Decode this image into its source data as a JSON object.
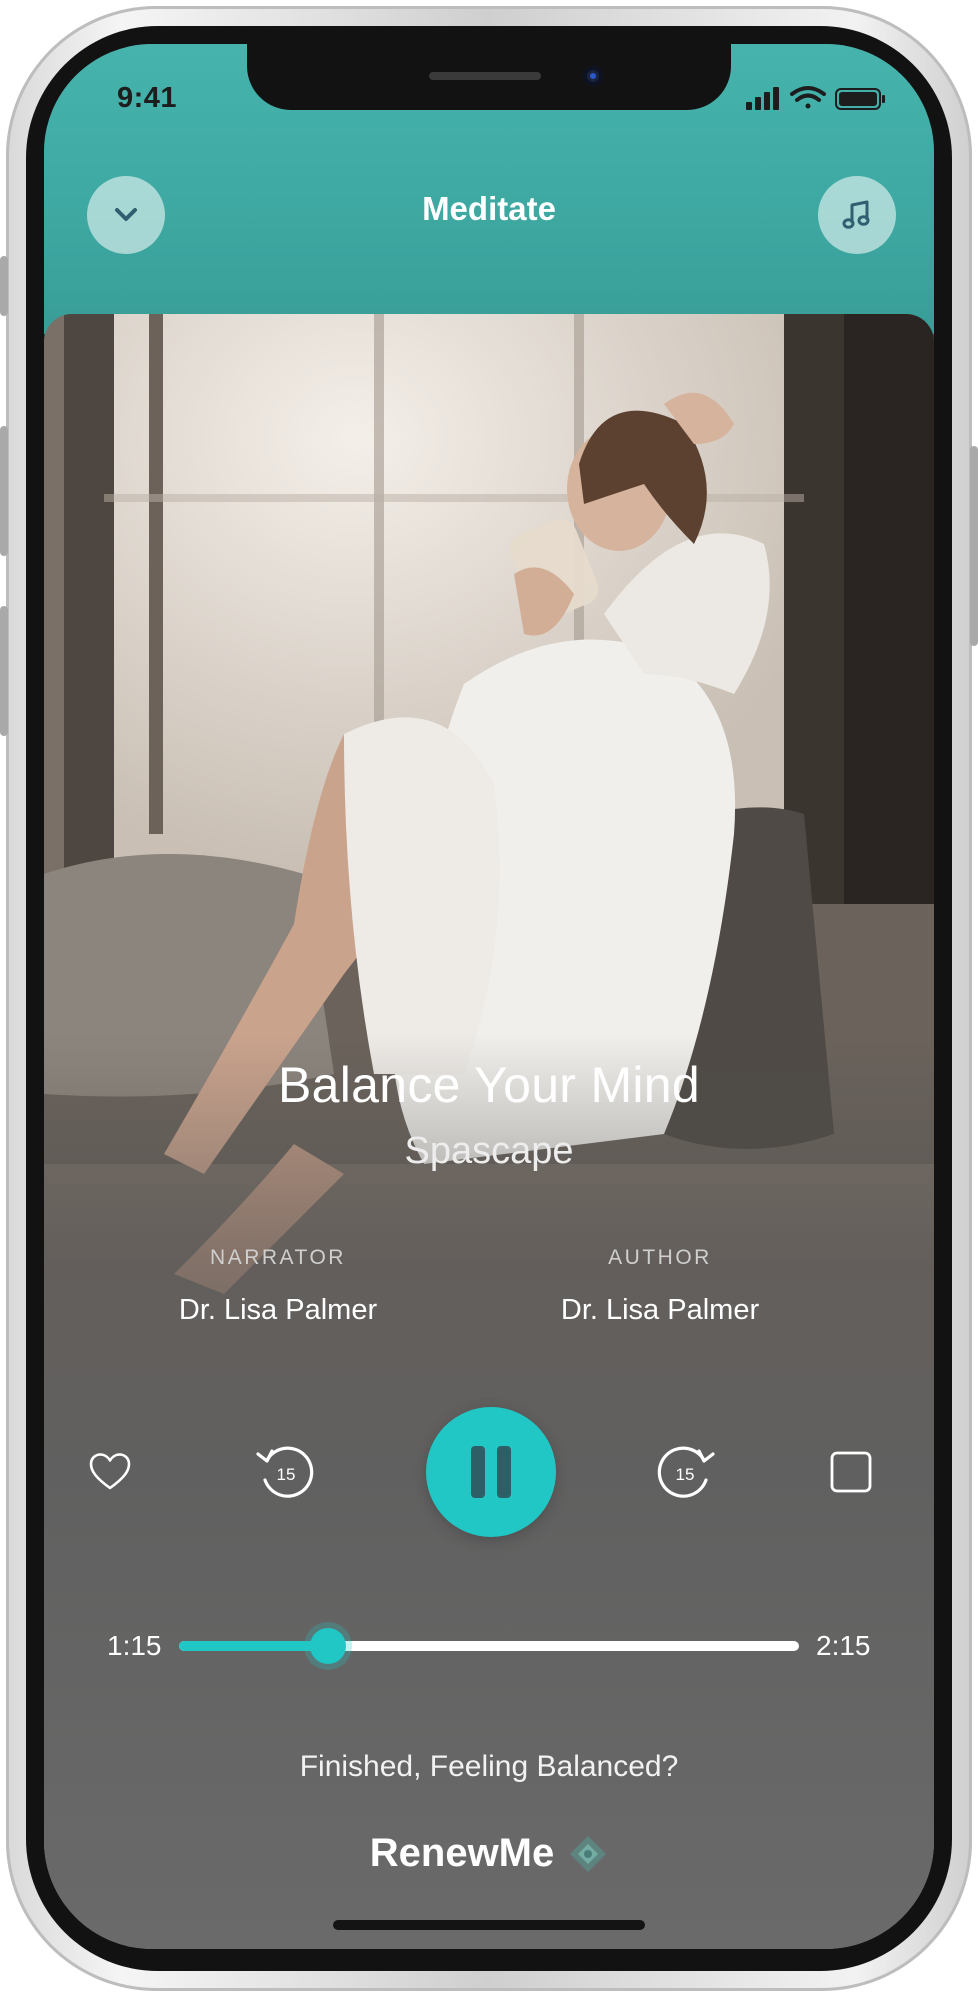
{
  "status_bar": {
    "time": "9:41"
  },
  "header": {
    "title": "Meditate",
    "collapse_icon": "chevron-down-icon",
    "music_icon": "music-note-icon"
  },
  "track": {
    "title": "Balance Your Mind",
    "subtitle": "Spascape"
  },
  "credits": {
    "narrator_label": "NARRATOR",
    "narrator_name": "Dr. Lisa Palmer",
    "author_label": "AUTHOR",
    "author_name": "Dr. Lisa Palmer"
  },
  "controls": {
    "favorite_icon": "heart-icon",
    "rewind_icon": "rewind-15-icon",
    "rewind_seconds": "15",
    "pause_icon": "pause-icon",
    "forward_icon": "forward-15-icon",
    "forward_seconds": "15",
    "stop_icon": "stop-icon"
  },
  "progress": {
    "elapsed": "1:15",
    "total": "2:15",
    "fraction": 0.24
  },
  "footer": {
    "prompt": "Finished, Feeling Balanced?",
    "brand": "RenewMe"
  },
  "colors": {
    "accent": "#20c7c5",
    "header": "#42aea8"
  }
}
